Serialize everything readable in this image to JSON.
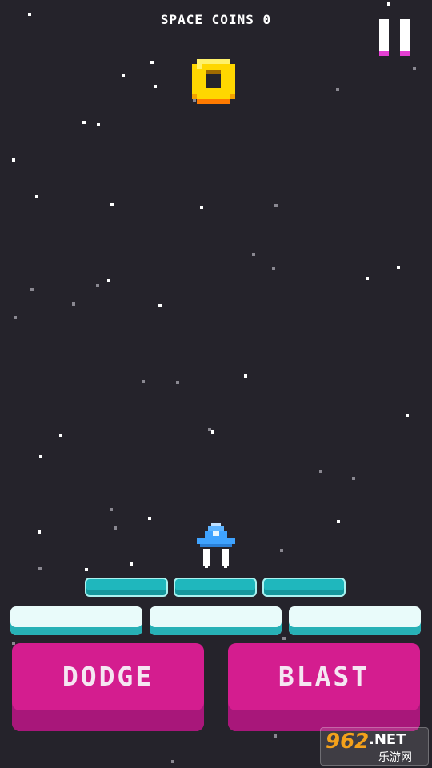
{
  "hud": {
    "coins_label": "SPACE COINS 0"
  },
  "controls": {
    "dodge_label": "DODGE",
    "blast_label": "BLAST"
  },
  "icons": {
    "pause": "pause-icon",
    "coin": "coin-icon",
    "ship": "spaceship-icon"
  },
  "colors": {
    "background": "#25232b",
    "accent_pink": "#d41d8f",
    "platform_teal": "#21b9bf",
    "coin_yellow": "#ffd700",
    "ship_blue": "#3fa3ff"
  },
  "watermark": {
    "number": "962",
    "domain": ".NET",
    "chinese": "乐游网"
  }
}
